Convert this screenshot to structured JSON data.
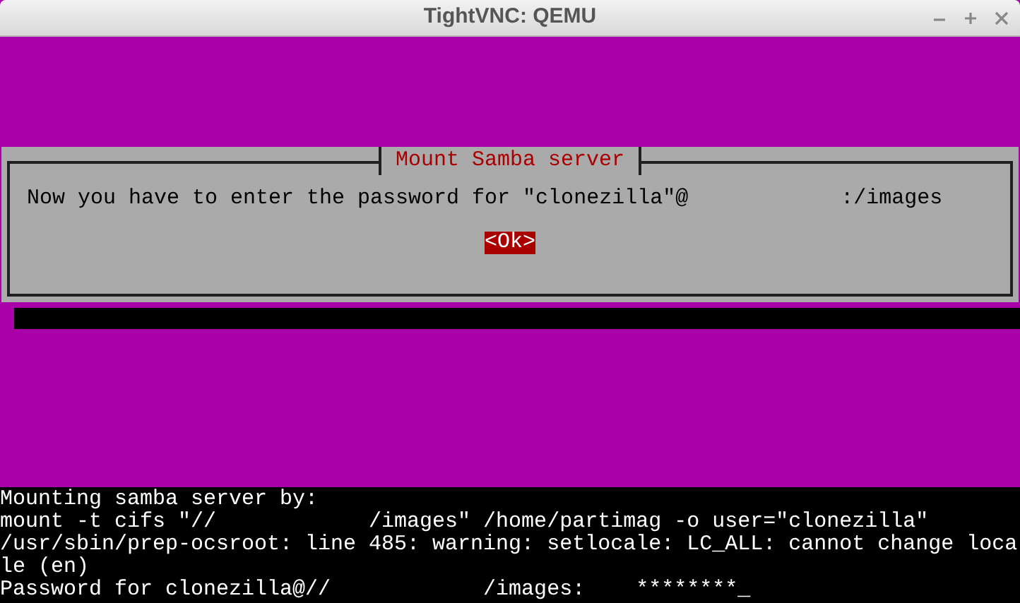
{
  "window": {
    "title": "TightVNC: QEMU"
  },
  "dialog": {
    "title": "Mount Samba server",
    "message": "Now you have to enter the password for \"clonezilla\"@            :/images",
    "button": {
      "label": "<Ok>",
      "selected": true
    }
  },
  "terminal": {
    "lines": [
      "Mounting samba server by:",
      "mount -t cifs \"//            /images\" /home/partimag -o user=\"clonezilla\"",
      "/usr/sbin/prep-ocsroot: line 485: warning: setlocale: LC_ALL: cannot change loca",
      "le (en)",
      "Password for clonezilla@//            /images:    ********_"
    ]
  }
}
